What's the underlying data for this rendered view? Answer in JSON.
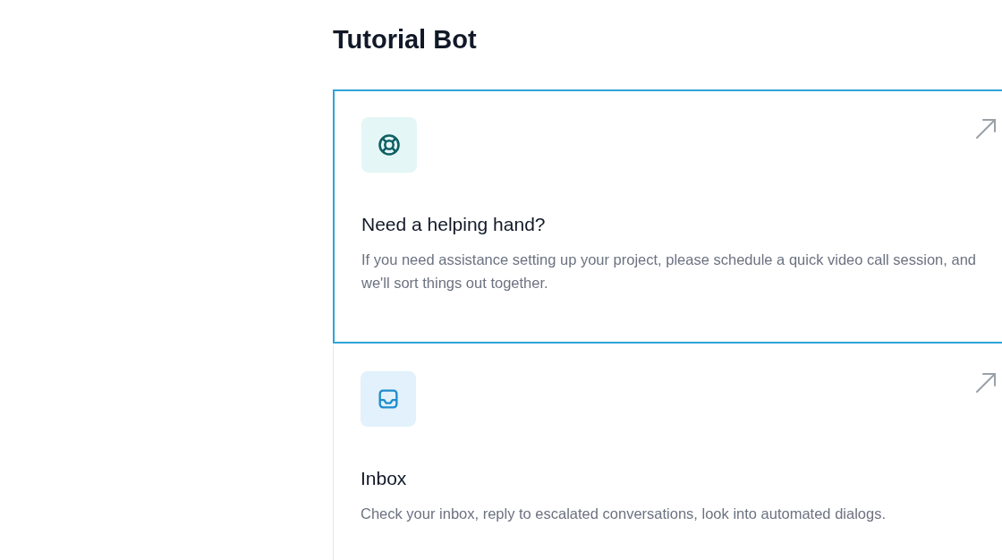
{
  "page": {
    "title": "Tutorial Bot"
  },
  "cards": [
    {
      "kind": "support",
      "title": "Need a helping hand?",
      "description": "If you need assistance setting up your project, please schedule a quick video call session, and we'll sort things out together.",
      "selected": true
    },
    {
      "kind": "inbox",
      "title": "Inbox",
      "description": "Check your inbox, reply to escalated conversations, look into automated dialogs.",
      "selected": false
    }
  ]
}
